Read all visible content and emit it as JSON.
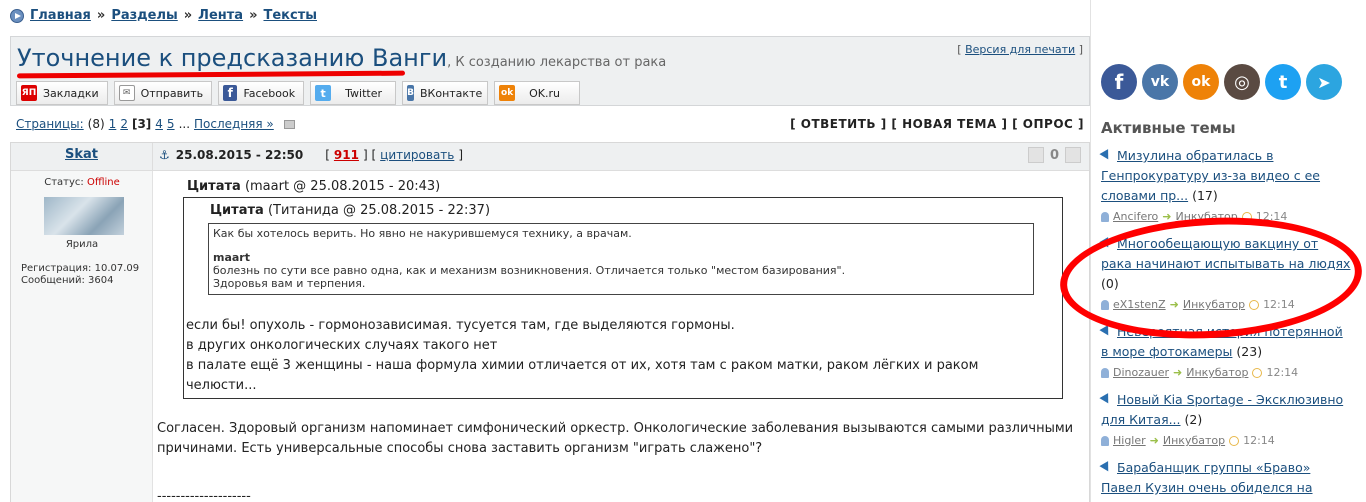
{
  "breadcrumb": [
    "Главная",
    "Разделы",
    "Лента",
    "Тексты"
  ],
  "breadcrumb_sep": "»",
  "topic": {
    "title": "Уточнение к предсказанию Ванги",
    "description": ", К созданию лекарства от рака",
    "print_version": "Версия для печати"
  },
  "share": [
    {
      "label": "Закладки",
      "icon": "ya-icon",
      "color": "#d00",
      "glyph": "ЯП"
    },
    {
      "label": "Отправить",
      "icon": "mail-icon",
      "color": "#999",
      "glyph": "✉"
    },
    {
      "label": "Facebook",
      "icon": "facebook-icon",
      "color": "#3b5998",
      "glyph": "f"
    },
    {
      "label": "Twitter",
      "icon": "twitter-icon",
      "color": "#55acee",
      "glyph": "t"
    },
    {
      "label": "ВКонтакте",
      "icon": "vk-icon",
      "color": "#4a76a8",
      "glyph": "B"
    },
    {
      "label": "OK.ru",
      "icon": "ok-icon",
      "color": "#ee8208",
      "glyph": "ok"
    }
  ],
  "pagination": {
    "label": "Страницы:",
    "total": "(8)",
    "pages": [
      "1",
      "2",
      "3",
      "4",
      "5"
    ],
    "current": "3",
    "ellipsis": "...",
    "last": "Последняя »"
  },
  "actions": [
    "[ ОТВЕТИТЬ ]",
    "[ НОВАЯ ТЕМА ]",
    "[ ОПРОС ]"
  ],
  "post": {
    "author": "Skat",
    "date": "25.08.2015 - 22:50",
    "number": "911",
    "quote_link": "цитировать",
    "votes": "0",
    "status_label": "Статус:",
    "status": "Offline",
    "user_title": "Ярила",
    "registered": "Регистрация: 10.07.09",
    "messages": "Сообщений: 3604",
    "quote1": {
      "label": "Цитата",
      "meta": "(maart @ 25.08.2015 - 20:43)",
      "text": [
        "если бы! опухоль - гормонозависимая. тусуется там, где выделяются гормоны.",
        "в других онкологических случаях такого нет",
        "в палате ещё 3 женщины - наша формула химии отличается от их, хотя там с раком матки, раком лёгких и раком челюсти..."
      ]
    },
    "quote2": {
      "label": "Цитата",
      "meta": "(Титанида @ 25.08.2015 - 22:37)",
      "line1": "Как бы хотелось верить. Но явно не накурившемуся технику, а врачам.",
      "author": "maart",
      "line2": "болезнь по сути все равно одна, как и механизм возникновения. Отличается только \"местом базирования\".",
      "line3": "Здоровья вам и терпения."
    },
    "reply": "Согласен. Здоровый организм напоминает симфонический оркестр. Онкологические заболевания вызываются самыми различными причинами. Есть универсальные способы снова заставить организм \"играть слажено\"?",
    "signature_line": "--------------------"
  },
  "sidebar": {
    "social": [
      {
        "icon": "facebook-icon",
        "color": "#3b5998",
        "glyph": "f"
      },
      {
        "icon": "vk-icon",
        "color": "#4a76a8",
        "glyph": "vk"
      },
      {
        "icon": "ok-icon",
        "color": "#ee8208",
        "glyph": "ok"
      },
      {
        "icon": "instagram-icon",
        "color": "#5a4a42",
        "glyph": "◎"
      },
      {
        "icon": "twitter-icon",
        "color": "#1da1f2",
        "glyph": "t"
      },
      {
        "icon": "telegram-icon",
        "color": "#2ca5e0",
        "glyph": "➤"
      }
    ],
    "title": "Активные темы",
    "topics": [
      {
        "title": "Мизулина обратилась в Генпрокуратуру из-за видео с ее словами пр...",
        "count": "(17)",
        "user": "Ancifero",
        "section": "Инкубатор",
        "time": "12:14"
      },
      {
        "title": "Многообещающую вакцину от рака начинают испытывать на людях",
        "count": "(0)",
        "user": "eX1stenZ",
        "section": "Инкубатор",
        "time": "12:14"
      },
      {
        "title": "Невероятная история потерянной в море фотокамеры",
        "count": "(23)",
        "user": "Dinozauer",
        "section": "Инкубатор",
        "time": "12:14"
      },
      {
        "title": "Новый Kia Sportage - Эксклюзивно для Китая...",
        "count": "(2)",
        "user": "Higler",
        "section": "Инкубатор",
        "time": "12:14"
      },
      {
        "title": "Барабанщик группы «Браво» Павел Кузин очень обиделся на",
        "count": "",
        "user": "",
        "section": "",
        "time": ""
      }
    ]
  }
}
